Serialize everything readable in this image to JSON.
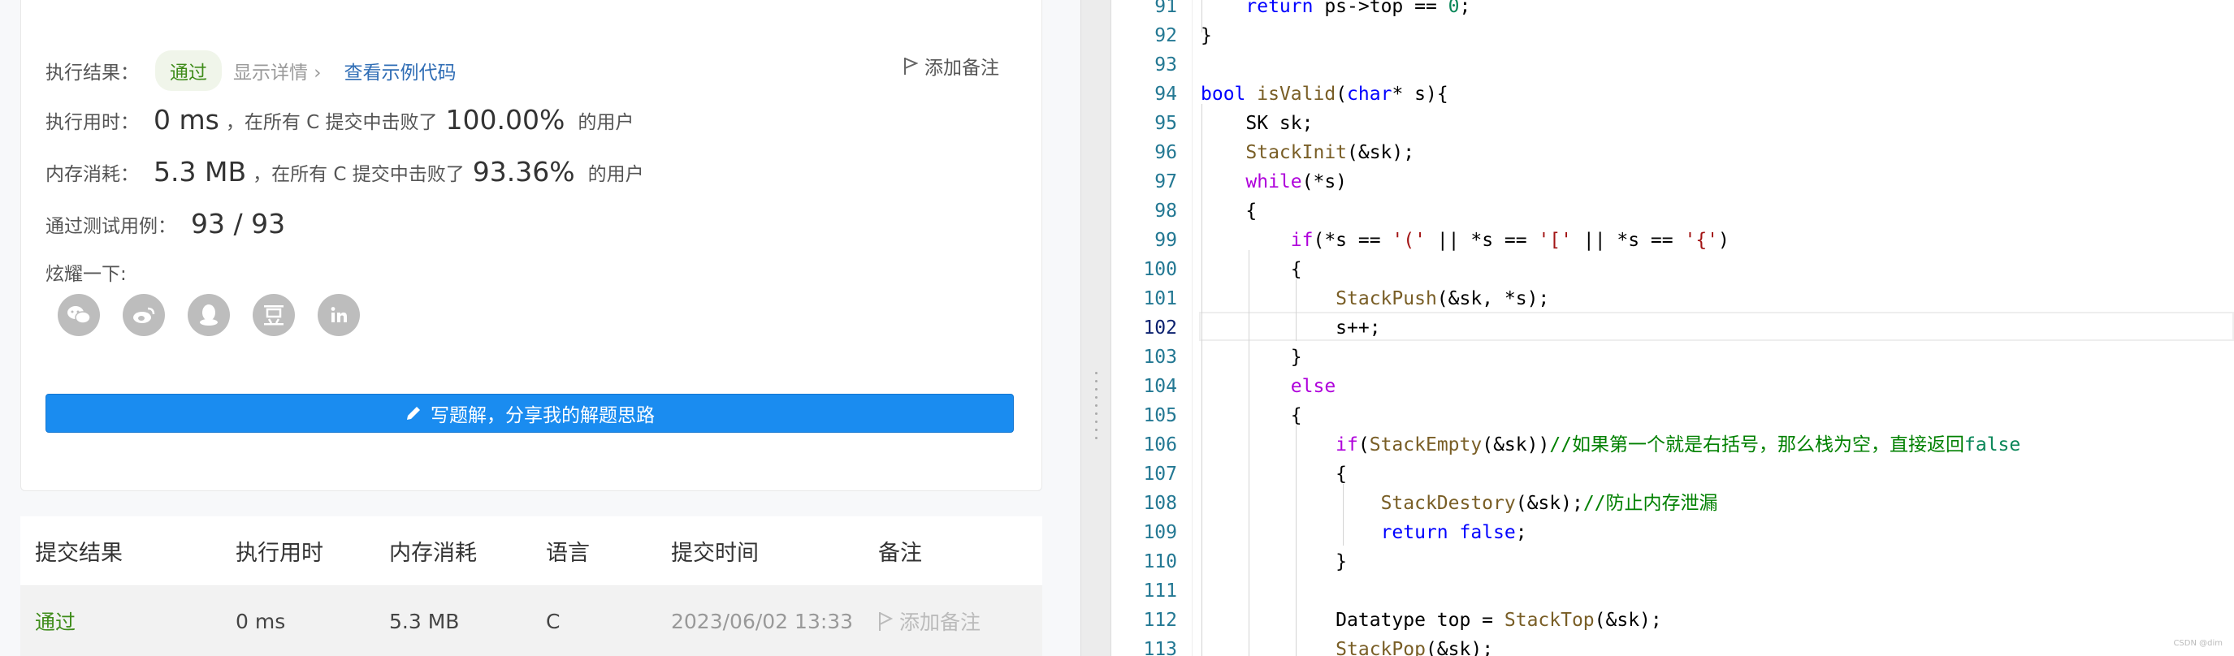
{
  "result": {
    "label": "执行结果：",
    "status": "通过",
    "detail_link": "显示详情 ›",
    "sample_link": "查看示例代码",
    "add_note": "添加备注"
  },
  "runtime": {
    "label": "执行用时：",
    "value": "0 ms",
    "beat_text": "，在所有 C 提交中击败了",
    "percent": "100.00%",
    "users": "的用户"
  },
  "memory": {
    "label": "内存消耗：",
    "value": "5.3 MB",
    "beat_text": "，在所有 C 提交中击败了",
    "percent": "93.36%",
    "users": "的用户"
  },
  "tests": {
    "label": "通过测试用例：",
    "value": "93 / 93"
  },
  "share": {
    "label": "炫耀一下:",
    "icons": [
      "wechat-icon",
      "weibo-icon",
      "qq-icon",
      "douban-icon",
      "linkedin-icon"
    ]
  },
  "write_button": "写题解，分享我的解题思路",
  "submissions": {
    "headers": [
      "提交结果",
      "执行用时",
      "内存消耗",
      "语言",
      "提交时间",
      "备注"
    ],
    "rows": [
      {
        "status": "通过",
        "time": "0 ms",
        "memory": "5.3 MB",
        "lang": "C",
        "submitted": "2023/06/02 13:33",
        "note": "添加备注"
      }
    ]
  },
  "editor": {
    "current_line": 102,
    "lines": [
      {
        "n": 91,
        "code": "    return ps->top == 0;"
      },
      {
        "n": 92,
        "code": "}"
      },
      {
        "n": 93,
        "code": ""
      },
      {
        "n": 94,
        "code": "bool isValid(char* s){"
      },
      {
        "n": 95,
        "code": "    SK sk;"
      },
      {
        "n": 96,
        "code": "    StackInit(&sk);"
      },
      {
        "n": 97,
        "code": "    while(*s)"
      },
      {
        "n": 98,
        "code": "    {"
      },
      {
        "n": 99,
        "code": "        if(*s == '(' || *s == '[' || *s == '{')"
      },
      {
        "n": 100,
        "code": "        {"
      },
      {
        "n": 101,
        "code": "            StackPush(&sk, *s);"
      },
      {
        "n": 102,
        "code": "            s++;"
      },
      {
        "n": 103,
        "code": "        }"
      },
      {
        "n": 104,
        "code": "        else"
      },
      {
        "n": 105,
        "code": "        {"
      },
      {
        "n": 106,
        "code": "            if(StackEmpty(&sk))//如果第一个就是右括号，那么栈为空，直接返回false"
      },
      {
        "n": 107,
        "code": "            {"
      },
      {
        "n": 108,
        "code": "                StackDestory(&sk);//防止内存泄漏"
      },
      {
        "n": 109,
        "code": "                return false;"
      },
      {
        "n": 110,
        "code": "            }"
      },
      {
        "n": 111,
        "code": ""
      },
      {
        "n": 112,
        "code": "            Datatype top = StackTop(&sk);"
      },
      {
        "n": 113,
        "code": "            StackPop(&sk);"
      }
    ]
  },
  "watermark": "CSDN @dim"
}
